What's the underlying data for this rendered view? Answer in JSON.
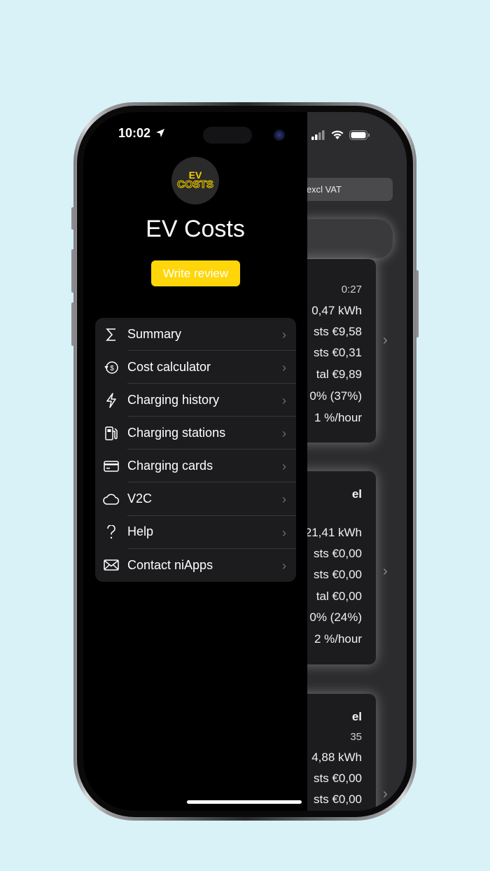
{
  "status_bar": {
    "time": "10:02",
    "location_icon": "location-arrow-icon",
    "icons": [
      "cellular-signal-icon",
      "wifi-icon",
      "battery-icon"
    ]
  },
  "drawer": {
    "logo": {
      "line1": "EV",
      "line2": "COSTS"
    },
    "app_title": "EV Costs",
    "review_button": "Write review",
    "review_color": "#ffd60a",
    "menu": [
      {
        "label": "Summary",
        "icon": "sigma-icon"
      },
      {
        "label": "Cost calculator",
        "icon": "cost-calculator-icon"
      },
      {
        "label": "Charging history",
        "icon": "lightning-icon"
      },
      {
        "label": "Charging stations",
        "icon": "fuel-pump-icon"
      },
      {
        "label": "Charging cards",
        "icon": "credit-card-icon"
      },
      {
        "label": "V2C",
        "icon": "cloud-icon"
      },
      {
        "label": "Help",
        "icon": "question-icon"
      },
      {
        "label": "Contact niApps",
        "icon": "envelope-icon"
      }
    ]
  },
  "background": {
    "vat_toggle": "e excl VAT",
    "cards": [
      {
        "title": "",
        "subtitle": "0:27",
        "lines": [
          "0,47 kWh",
          "sts  €9,58",
          "sts  €0,31",
          "tal  €9,89",
          "0% (37%)",
          "1  %/hour"
        ]
      },
      {
        "title": "el",
        "subtitle": "",
        "lines": [
          "21,41 kWh",
          "sts  €0,00",
          "sts  €0,00",
          "tal  €0,00",
          "0% (24%)",
          "2  %/hour"
        ]
      },
      {
        "title": "el",
        "subtitle": "35",
        "lines": [
          "4,88 kWh",
          "sts  €0,00",
          "sts  €0,00"
        ]
      }
    ]
  }
}
